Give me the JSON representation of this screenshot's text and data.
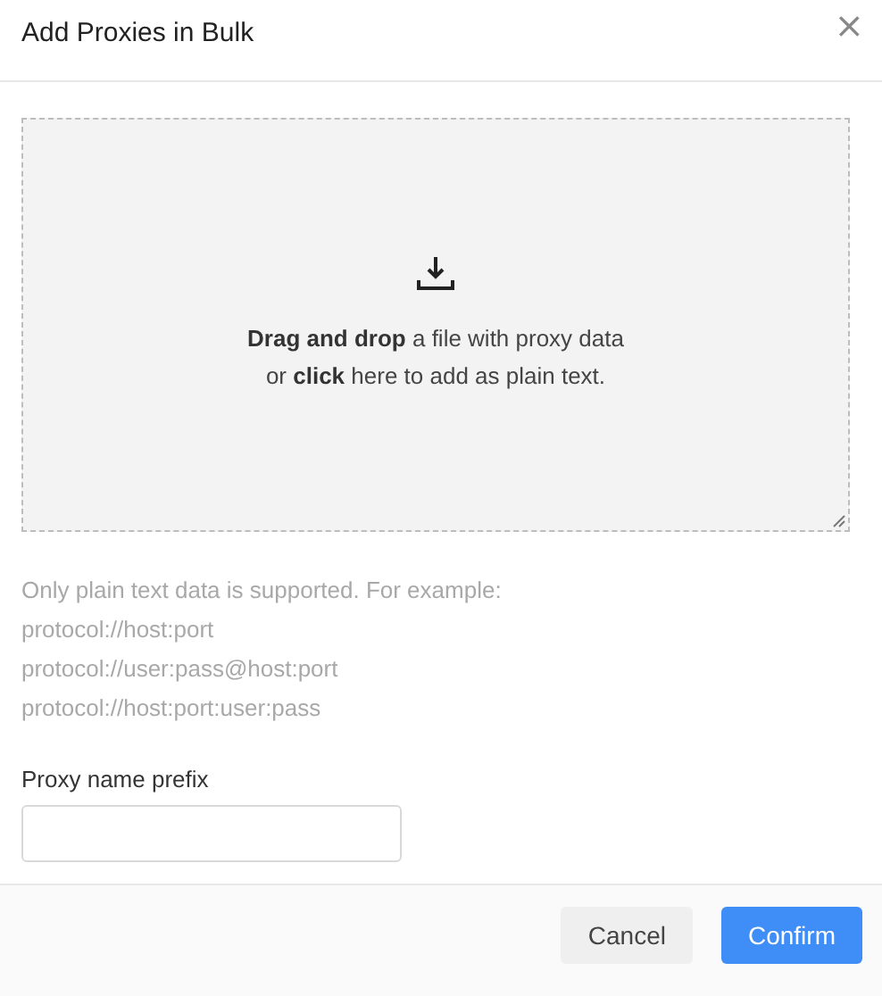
{
  "dialog": {
    "title": "Add Proxies in Bulk",
    "close": "×"
  },
  "dropzone": {
    "text_lines": [
      "**Drag and drop** a file with proxy data",
      "or **click** here to add as plain text."
    ]
  },
  "help_lines": [
    "Only plain text data is supported. For example:",
    "protocol://host:port",
    "protocol://user:pass@host:port",
    "protocol://host:port:user:pass"
  ],
  "prefix_field": {
    "label": "Proxy name prefix"
  },
  "buttons": [
    {
      "label": "Cancel",
      "kind": "secondary"
    },
    {
      "label": "Confirm",
      "kind": "primary"
    }
  ]
}
